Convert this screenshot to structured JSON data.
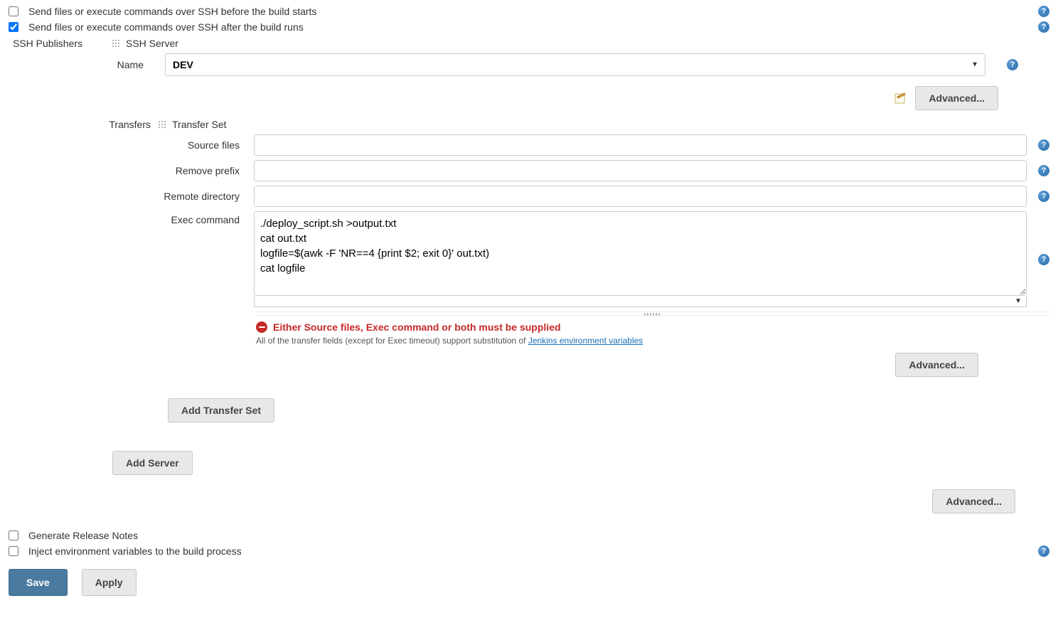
{
  "checkboxes": {
    "before_build": {
      "label": "Send files or execute commands over SSH before the build starts",
      "checked": false
    },
    "after_build": {
      "label": "Send files or execute commands over SSH after the build runs",
      "checked": true
    },
    "release_notes": {
      "label": "Generate Release Notes",
      "checked": false
    },
    "inject_env": {
      "label": "Inject environment variables to the build process",
      "checked": false
    }
  },
  "labels": {
    "ssh_publishers": "SSH Publishers",
    "ssh_server": "SSH Server",
    "name": "Name",
    "transfers": "Transfers",
    "transfer_set": "Transfer Set",
    "source_files": "Source files",
    "remove_prefix": "Remove prefix",
    "remote_directory": "Remote directory",
    "exec_command": "Exec command"
  },
  "server": {
    "selected": "DEV",
    "options": [
      "DEV"
    ]
  },
  "transfer": {
    "source_files": "",
    "remove_prefix": "",
    "remote_directory": "",
    "exec_command": "./deploy_script.sh >output.txt\ncat out.txt\nlogfile=$(awk -F 'NR==4 {print $2; exit 0}' out.txt)\ncat logfile"
  },
  "error": "Either Source files, Exec command or both must be supplied",
  "note_prefix": "All of the transfer fields (except for Exec timeout) support substitution of ",
  "note_link": "Jenkins environment variables",
  "buttons": {
    "advanced": "Advanced...",
    "add_transfer": "Add Transfer Set",
    "add_server": "Add Server",
    "save": "Save",
    "apply": "Apply"
  }
}
